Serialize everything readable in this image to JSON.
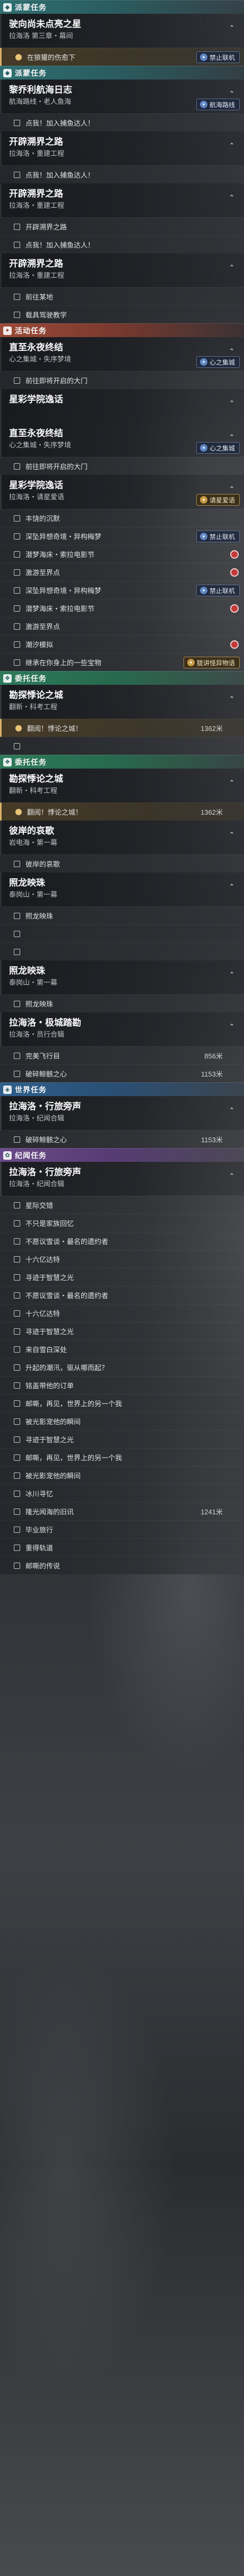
{
  "rows": [
    {
      "k": "cat",
      "c": "c-teal",
      "icon": "◆",
      "title": "派蒙任务",
      "icon_name": "compass-icon"
    },
    {
      "k": "qh",
      "title": "驶向尚未点亮之星",
      "sub": "拉海洛 第三章・幕间",
      "sel": false
    },
    {
      "k": "st",
      "text": "在狼獾的伤愈下",
      "track": true,
      "badge": {
        "text": "禁止联机",
        "style": "blue"
      }
    },
    {
      "k": "cat",
      "c": "c-teal",
      "icon": "◆",
      "title": "派蒙任务",
      "icon_name": "compass-icon"
    },
    {
      "k": "qh",
      "title": "黎乔利航海日志",
      "sub": "航海路线・老人鱼海",
      "badge": {
        "text": "航海路线",
        "style": "blue"
      }
    },
    {
      "k": "st",
      "text": "点我！加入捕鱼达人！"
    },
    {
      "k": "qh",
      "title": "开辟溯界之路",
      "sub": "拉海洛・重建工程"
    },
    {
      "k": "st",
      "text": "点我！加入捕鱼达人！"
    },
    {
      "k": "qh",
      "title": "开辟溯界之路",
      "sub": "拉海洛・重建工程"
    },
    {
      "k": "st",
      "text": "开辟溯界之路"
    },
    {
      "k": "st",
      "text": "点我！加入捕鱼达人！"
    },
    {
      "k": "qh",
      "title": "开辟溯界之路",
      "sub": "拉海洛・重建工程"
    },
    {
      "k": "st",
      "text": "前往某地"
    },
    {
      "k": "st",
      "text": "载具驾驶教学"
    },
    {
      "k": "cat",
      "c": "c-red",
      "icon": "✦",
      "title": "活动任务",
      "icon_name": "star-icon"
    },
    {
      "k": "qh",
      "title": "直至永夜终结",
      "sub": "心之集城・失序梦境",
      "badge": {
        "text": "心之集城",
        "style": "blue"
      }
    },
    {
      "k": "st",
      "text": "前往即将开启的大门"
    },
    {
      "k": "qh",
      "title": "星彩学院逸话",
      "sub": ""
    },
    {
      "k": "qh",
      "title": "直至永夜终结",
      "sub": "心之集城・失序梦境",
      "badge": {
        "text": "心之集城",
        "style": "blue"
      }
    },
    {
      "k": "st",
      "text": "前往即将开启的大门"
    },
    {
      "k": "qh",
      "title": "星彩学院逸话",
      "sub": "拉海洛・请星爱语",
      "badge": {
        "text": "请星爱语",
        "style": "gold"
      }
    },
    {
      "k": "st",
      "text": "丰饶的沉默"
    },
    {
      "k": "st",
      "text": "深坠异想奇境・异构梅梦",
      "badge": {
        "text": "禁止联机",
        "style": "blue"
      }
    },
    {
      "k": "st",
      "text": "潜梦海床・索拉电影节",
      "marker": true
    },
    {
      "k": "st",
      "text": "激游至界点",
      "marker": true
    },
    {
      "k": "st",
      "text": "深坠异想奇境・异构梅梦",
      "badge": {
        "text": "禁止联机",
        "style": "blue"
      }
    },
    {
      "k": "st",
      "text": "潜梦海床・索拉电影节",
      "marker": true
    },
    {
      "k": "st",
      "text": "激游至界点"
    },
    {
      "k": "st",
      "text": "潮汐模拟",
      "marker": true
    },
    {
      "k": "st",
      "text": "继承在你身上的一些宝物",
      "badge": {
        "text": "胧讲怪异物语",
        "style": "gold"
      }
    },
    {
      "k": "cat",
      "c": "c-green",
      "icon": "❖",
      "title": "委托任务",
      "icon_name": "diamond-icon"
    },
    {
      "k": "qh",
      "title": "勘探悸论之城",
      "sub": "翻新・科考工程"
    },
    {
      "k": "st",
      "text": "翻阅！悸论之城！",
      "dist": "1362米",
      "track": true
    },
    {
      "k": "st",
      "text": ""
    },
    {
      "k": "cat",
      "c": "c-green",
      "icon": "❖",
      "title": "委托任务",
      "icon_name": "diamond-icon"
    },
    {
      "k": "qh",
      "title": "勘探悸论之城",
      "sub": "翻新・科考工程"
    },
    {
      "k": "st",
      "text": "翻阅！悸论之城！",
      "dist": "1362米",
      "track": true
    },
    {
      "k": "qh",
      "title": "彼岸的哀歌",
      "sub": "岩电海・第一幕"
    },
    {
      "k": "st",
      "text": "彼岸的哀歌"
    },
    {
      "k": "qh",
      "title": "照龙映珠",
      "sub": "泰岗山・第一幕"
    },
    {
      "k": "st",
      "text": "照龙映珠"
    },
    {
      "k": "st",
      "text": ""
    },
    {
      "k": "st",
      "text": ""
    },
    {
      "k": "qh",
      "title": "照龙映珠",
      "sub": "泰岗山・第一幕"
    },
    {
      "k": "st",
      "text": "照龙映珠"
    },
    {
      "k": "qh",
      "title": "拉海洛・极城踏勘",
      "sub": "拉海洛・员行合辑"
    },
    {
      "k": "st",
      "text": "完美飞行目",
      "dist": "856米"
    },
    {
      "k": "st",
      "text": "破碎鲸骸之心",
      "dist": "1153米"
    },
    {
      "k": "cat",
      "c": "c-blue",
      "icon": "◈",
      "title": "世界任务",
      "icon_name": "globe-icon"
    },
    {
      "k": "qh",
      "title": "拉海洛・行旅旁声",
      "sub": "拉海洛・纪闻合辑"
    },
    {
      "k": "st",
      "text": "破碎鲸骸之心",
      "dist": "1153米"
    },
    {
      "k": "cat",
      "c": "c-purple",
      "icon": "✿",
      "title": "纪闻任务",
      "icon_name": "book-icon"
    },
    {
      "k": "qh",
      "title": "拉海洛・行旅旁声",
      "sub": "拉海洛・纪闻合辑"
    },
    {
      "k": "st",
      "text": "星际交错"
    },
    {
      "k": "st",
      "text": "不只是家族回忆"
    },
    {
      "k": "st",
      "text": "不愿议雪谈・最名的遗约者"
    },
    {
      "k": "st",
      "text": "十六亿达特"
    },
    {
      "k": "st",
      "text": "寻迹于智慧之光"
    },
    {
      "k": "st",
      "text": "不愿议雪谈・最名的遗约者"
    },
    {
      "k": "st",
      "text": "十六亿达特"
    },
    {
      "k": "st",
      "text": "寻迹于智慧之光"
    },
    {
      "k": "st",
      "text": "来自雪白深处"
    },
    {
      "k": "st",
      "text": "升起的潮汛，驱从哪而起？"
    },
    {
      "k": "st",
      "text": "铭盖带他的订单"
    },
    {
      "k": "st",
      "text": "邮嘶，再见，世界上的另一个我"
    },
    {
      "k": "st",
      "text": "被光影宠他的瞬间"
    },
    {
      "k": "st",
      "text": "寻迹于智慧之光"
    },
    {
      "k": "st",
      "text": "邮嘶，再见，世界上的另一个我"
    },
    {
      "k": "st",
      "text": "被光影宠他的瞬间"
    },
    {
      "k": "st",
      "text": "冰川寻忆"
    },
    {
      "k": "st",
      "text": "隆光闻海的旧讯",
      "dist": "1241米"
    },
    {
      "k": "st",
      "text": "毕业旅行"
    },
    {
      "k": "st",
      "text": "重得轨道"
    },
    {
      "k": "st",
      "text": "邮嘶的传说"
    }
  ]
}
